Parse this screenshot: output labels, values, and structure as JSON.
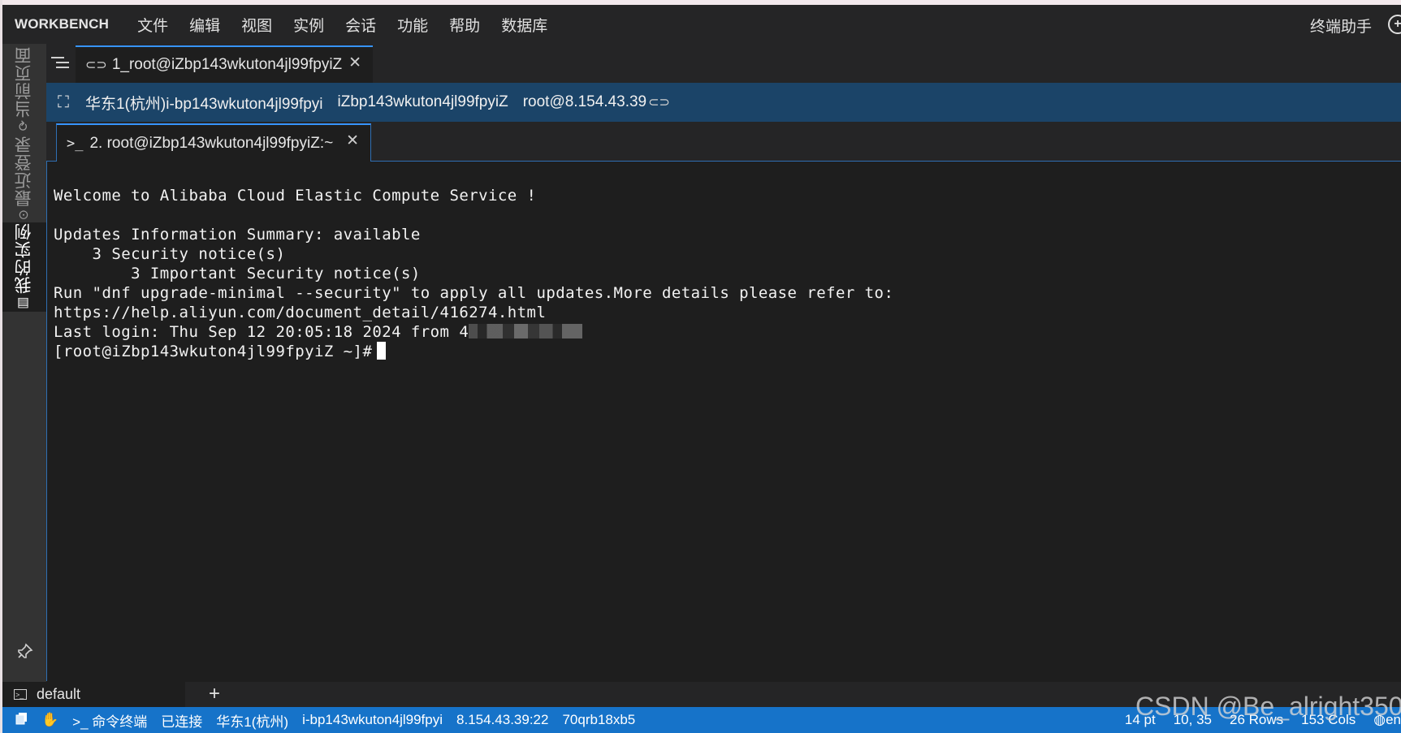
{
  "menubar": {
    "brand": "WORKBENCH",
    "items": [
      "文件",
      "编辑",
      "视图",
      "实例",
      "会话",
      "功能",
      "帮助",
      "数据库"
    ],
    "assistant": "终端助手",
    "plus_icon": "⊕"
  },
  "sidebar": {
    "tabs": [
      {
        "label": "当前页面",
        "icon": "⟳"
      },
      {
        "label": "最近登录",
        "icon": "⊙"
      },
      {
        "label": "我的实例",
        "icon": "▤"
      }
    ],
    "pin_icon": "pin-icon"
  },
  "session_tab": {
    "label": "1_root@iZbp143wkuton4jl99fpyiZ",
    "close": "✕"
  },
  "infobar": {
    "region_instance": "华东1(杭州)i-bp143wkuton4jl99fpyi",
    "hostname": "iZbp143wkuton4jl99fpyiZ",
    "user_ip": "root@8.154.43.39"
  },
  "terminal_tab": {
    "label": "2. root@iZbp143wkuton4jl99fpyiZ:~",
    "close": "✕"
  },
  "terminal": {
    "lines": [
      "Welcome to Alibaba Cloud Elastic Compute Service !",
      "",
      "Updates Information Summary: available",
      "    3 Security notice(s)",
      "        3 Important Security notice(s)",
      "Run \"dnf upgrade-minimal --security\" to apply all updates.More details please refer to:",
      "https://help.aliyun.com/document_detail/416274.html"
    ],
    "last_login": "Last login: Thu Sep 12 20:05:18 2024 from 4",
    "prompt": "[root@iZbp143wkuton4jl99fpyiZ ~]#"
  },
  "panel": {
    "tab_label": "default",
    "add": "+"
  },
  "statusbar": {
    "mode": "命令终端",
    "state": "已连接",
    "region": "华东1(杭州)",
    "instance": "i-bp143wkuton4jl99fpyi",
    "address": "8.154.43.39:22",
    "session_id": "70qrb18xb5",
    "font_size": "14 pt",
    "cursor": "10, 35",
    "rows": "26 Rows",
    "cols": "153 Cols",
    "lang": "en"
  },
  "watermark": "CSDN @Be_alright350",
  "colors": {
    "accent": "#3794ff",
    "statusbar": "#1673c9",
    "infobar": "#1b4468"
  }
}
